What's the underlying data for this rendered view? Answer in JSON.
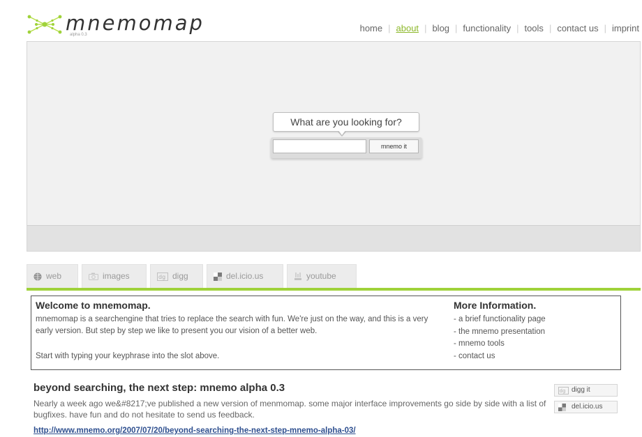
{
  "header": {
    "logo_text": "mnemomap",
    "version": "alpha 0.3",
    "nav": [
      {
        "label": "home",
        "active": false
      },
      {
        "label": "about",
        "active": true
      },
      {
        "label": "blog",
        "active": false
      },
      {
        "label": "functionality",
        "active": false
      },
      {
        "label": "tools",
        "active": false
      },
      {
        "label": "contact us",
        "active": false
      },
      {
        "label": "imprint",
        "active": false
      }
    ]
  },
  "search": {
    "prompt": "What are you looking for?",
    "input_value": "",
    "button_label": "mnemo it"
  },
  "tabs": [
    {
      "label": "web",
      "icon": "globe-icon"
    },
    {
      "label": "images",
      "icon": "camera-icon"
    },
    {
      "label": "digg",
      "icon": "digg-icon"
    },
    {
      "label": "del.icio.us",
      "icon": "delicious-icon"
    },
    {
      "label": "youtube",
      "icon": "youtube-icon"
    }
  ],
  "welcome": {
    "title": "Welcome to mnemomap.",
    "text": "mnemomap is a searchengine that tries to replace the search with fun. We're just on the way, and this is a very early version. But step by step we like to present you our vision of a better web.",
    "start": "Start with typing your keyphrase into the slot above.",
    "more_title": "More Information.",
    "more_links": [
      "- a brief functionality page",
      "- the mnemo presentation",
      "- mnemo tools",
      "- contact us"
    ]
  },
  "blog": {
    "title": "beyond searching, the next step: mnemo alpha 0.3",
    "excerpt": "Nearly a week ago we&#8217;ve published a new version of menmomap. some major interface improvements go side by side with a list of bugfixes. have fun and do not hesitate to send us feedback.",
    "link": "http://www.mnemo.org/2007/07/20/beyond-searching-the-next-step-mnemo-alpha-03/",
    "share_buttons": [
      {
        "label": "digg it",
        "icon": "digg-icon"
      },
      {
        "label": "del.icio.us",
        "icon": "delicious-icon"
      }
    ]
  },
  "colors": {
    "accent": "#9fd23a",
    "active_nav": "#8db82b",
    "link": "#2e4f8f"
  }
}
